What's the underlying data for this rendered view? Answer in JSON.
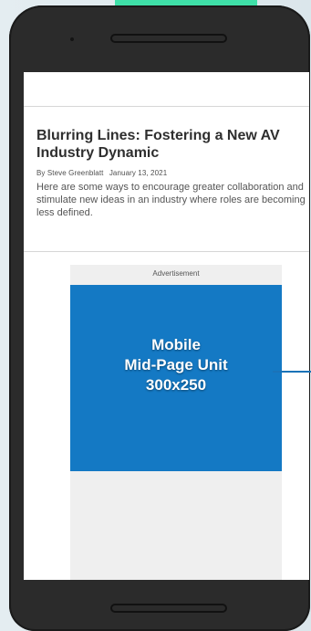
{
  "article": {
    "headline": "Blurring Lines: Fostering a New AV Industry Dynamic",
    "author": "By Steve Greenblatt",
    "date": "January 13, 2021",
    "summary": "Here are some ways to encourage greater collaboration and stimulate new ideas in an industry where roles are becoming less defined."
  },
  "ad": {
    "label": "Advertisement",
    "lines": [
      "Mobile",
      "Mid-Page Unit",
      "300x250"
    ],
    "color": "#1479c4"
  },
  "colors": {
    "accent_bar": "#3fe0a8",
    "phone_body": "#2b2b2b",
    "connector": "#1a73b8"
  }
}
